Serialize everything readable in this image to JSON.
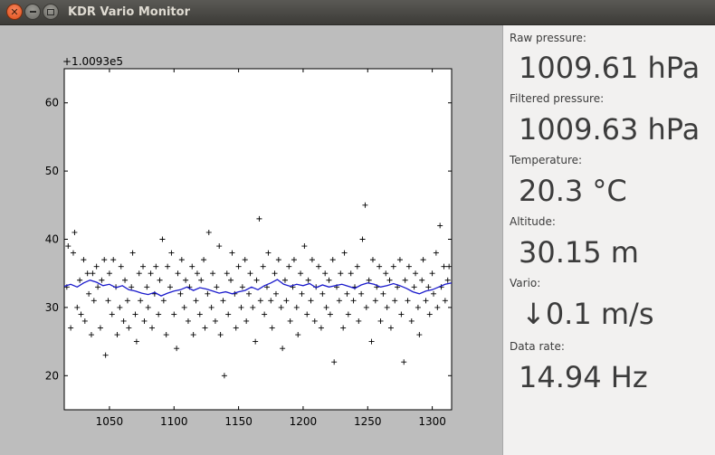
{
  "window": {
    "title": "KDR Vario Monitor",
    "close_glyph": "✕"
  },
  "readings": {
    "raw_pressure_label": "Raw pressure:",
    "raw_pressure_value": "1009.61 hPa",
    "filtered_pressure_label": "Filtered pressure:",
    "filtered_pressure_value": "1009.63 hPa",
    "temperature_label": "Temperature:",
    "temperature_value": "20.3 °C",
    "altitude_label": "Altitude:",
    "altitude_value": "30.15 m",
    "vario_label": "Vario:",
    "vario_value": "↓0.1 m/s",
    "data_rate_label": "Data rate:",
    "data_rate_value": "14.94 Hz"
  },
  "chart_data": {
    "type": "scatter",
    "offset_label": "+1.0093e5",
    "xlim": [
      1015,
      1315
    ],
    "ylim": [
      15,
      65
    ],
    "x_ticks": [
      1050,
      1100,
      1150,
      1200,
      1250,
      1300
    ],
    "y_ticks": [
      20,
      30,
      40,
      50,
      60
    ],
    "grid": false,
    "colors": {
      "raw": "#000000",
      "filtered": "#1a1acc"
    },
    "raw_points": [
      [
        1017,
        33
      ],
      [
        1018,
        39
      ],
      [
        1020,
        27
      ],
      [
        1022,
        38
      ],
      [
        1023,
        41
      ],
      [
        1025,
        30
      ],
      [
        1027,
        34
      ],
      [
        1028,
        29
      ],
      [
        1030,
        37
      ],
      [
        1031,
        28
      ],
      [
        1033,
        35
      ],
      [
        1034,
        32
      ],
      [
        1036,
        26
      ],
      [
        1037,
        35
      ],
      [
        1038,
        31
      ],
      [
        1040,
        36
      ],
      [
        1041,
        33
      ],
      [
        1043,
        27
      ],
      [
        1044,
        34
      ],
      [
        1046,
        37
      ],
      [
        1047,
        23
      ],
      [
        1049,
        31
      ],
      [
        1050,
        35
      ],
      [
        1052,
        29
      ],
      [
        1053,
        37
      ],
      [
        1055,
        33
      ],
      [
        1056,
        26
      ],
      [
        1058,
        30
      ],
      [
        1059,
        36
      ],
      [
        1061,
        28
      ],
      [
        1062,
        34
      ],
      [
        1064,
        31
      ],
      [
        1065,
        27
      ],
      [
        1067,
        33
      ],
      [
        1068,
        38
      ],
      [
        1070,
        29
      ],
      [
        1071,
        25
      ],
      [
        1073,
        35
      ],
      [
        1074,
        31
      ],
      [
        1076,
        36
      ],
      [
        1077,
        28
      ],
      [
        1079,
        33
      ],
      [
        1080,
        30
      ],
      [
        1082,
        35
      ],
      [
        1083,
        27
      ],
      [
        1085,
        32
      ],
      [
        1086,
        36
      ],
      [
        1088,
        29
      ],
      [
        1089,
        34
      ],
      [
        1091,
        40
      ],
      [
        1092,
        31
      ],
      [
        1094,
        26
      ],
      [
        1095,
        36
      ],
      [
        1097,
        33
      ],
      [
        1098,
        38
      ],
      [
        1100,
        29
      ],
      [
        1102,
        24
      ],
      [
        1103,
        35
      ],
      [
        1105,
        32
      ],
      [
        1106,
        37
      ],
      [
        1108,
        30
      ],
      [
        1109,
        34
      ],
      [
        1111,
        28
      ],
      [
        1112,
        33
      ],
      [
        1114,
        36
      ],
      [
        1115,
        26
      ],
      [
        1117,
        31
      ],
      [
        1118,
        35
      ],
      [
        1120,
        29
      ],
      [
        1121,
        34
      ],
      [
        1123,
        37
      ],
      [
        1124,
        27
      ],
      [
        1126,
        32
      ],
      [
        1127,
        41
      ],
      [
        1129,
        30
      ],
      [
        1130,
        35
      ],
      [
        1132,
        28
      ],
      [
        1133,
        33
      ],
      [
        1135,
        39
      ],
      [
        1136,
        26
      ],
      [
        1138,
        31
      ],
      [
        1139,
        20
      ],
      [
        1141,
        35
      ],
      [
        1142,
        29
      ],
      [
        1144,
        34
      ],
      [
        1145,
        38
      ],
      [
        1147,
        32
      ],
      [
        1148,
        27
      ],
      [
        1150,
        36
      ],
      [
        1152,
        30
      ],
      [
        1153,
        33
      ],
      [
        1155,
        37
      ],
      [
        1156,
        28
      ],
      [
        1158,
        32
      ],
      [
        1159,
        35
      ],
      [
        1161,
        30
      ],
      [
        1163,
        25
      ],
      [
        1164,
        34
      ],
      [
        1166,
        43
      ],
      [
        1167,
        31
      ],
      [
        1169,
        36
      ],
      [
        1170,
        29
      ],
      [
        1172,
        33
      ],
      [
        1173,
        38
      ],
      [
        1175,
        31
      ],
      [
        1176,
        27
      ],
      [
        1178,
        35
      ],
      [
        1179,
        32
      ],
      [
        1181,
        37
      ],
      [
        1183,
        30
      ],
      [
        1184,
        24
      ],
      [
        1186,
        34
      ],
      [
        1187,
        31
      ],
      [
        1189,
        36
      ],
      [
        1190,
        28
      ],
      [
        1192,
        33
      ],
      [
        1193,
        37
      ],
      [
        1195,
        30
      ],
      [
        1196,
        26
      ],
      [
        1198,
        35
      ],
      [
        1199,
        32
      ],
      [
        1201,
        39
      ],
      [
        1203,
        29
      ],
      [
        1204,
        34
      ],
      [
        1206,
        31
      ],
      [
        1207,
        37
      ],
      [
        1209,
        28
      ],
      [
        1210,
        33
      ],
      [
        1212,
        36
      ],
      [
        1214,
        27
      ],
      [
        1215,
        32
      ],
      [
        1217,
        35
      ],
      [
        1218,
        30
      ],
      [
        1220,
        34
      ],
      [
        1221,
        29
      ],
      [
        1223,
        37
      ],
      [
        1224,
        22
      ],
      [
        1226,
        33
      ],
      [
        1228,
        31
      ],
      [
        1229,
        35
      ],
      [
        1231,
        27
      ],
      [
        1232,
        38
      ],
      [
        1234,
        32
      ],
      [
        1235,
        29
      ],
      [
        1237,
        35
      ],
      [
        1239,
        31
      ],
      [
        1240,
        33
      ],
      [
        1242,
        36
      ],
      [
        1243,
        28
      ],
      [
        1245,
        32
      ],
      [
        1246,
        40
      ],
      [
        1248,
        45
      ],
      [
        1249,
        30
      ],
      [
        1251,
        34
      ],
      [
        1253,
        25
      ],
      [
        1254,
        37
      ],
      [
        1256,
        31
      ],
      [
        1257,
        33
      ],
      [
        1259,
        36
      ],
      [
        1260,
        28
      ],
      [
        1262,
        32
      ],
      [
        1264,
        35
      ],
      [
        1265,
        30
      ],
      [
        1267,
        34
      ],
      [
        1268,
        27
      ],
      [
        1270,
        36
      ],
      [
        1271,
        31
      ],
      [
        1273,
        33
      ],
      [
        1275,
        37
      ],
      [
        1276,
        29
      ],
      [
        1278,
        22
      ],
      [
        1279,
        34
      ],
      [
        1281,
        31
      ],
      [
        1282,
        36
      ],
      [
        1284,
        28
      ],
      [
        1286,
        33
      ],
      [
        1287,
        35
      ],
      [
        1289,
        30
      ],
      [
        1290,
        26
      ],
      [
        1292,
        34
      ],
      [
        1293,
        37
      ],
      [
        1295,
        31
      ],
      [
        1297,
        33
      ],
      [
        1298,
        29
      ],
      [
        1300,
        35
      ],
      [
        1301,
        32
      ],
      [
        1303,
        38
      ],
      [
        1304,
        30
      ],
      [
        1306,
        42
      ],
      [
        1307,
        33
      ],
      [
        1309,
        36
      ],
      [
        1310,
        31
      ],
      [
        1312,
        34
      ],
      [
        1313,
        36
      ]
    ],
    "filtered_line": [
      [
        1015,
        33.1
      ],
      [
        1020,
        33.4
      ],
      [
        1025,
        33.0
      ],
      [
        1030,
        33.6
      ],
      [
        1035,
        34.0
      ],
      [
        1040,
        33.7
      ],
      [
        1045,
        33.2
      ],
      [
        1050,
        33.4
      ],
      [
        1055,
        32.9
      ],
      [
        1060,
        33.2
      ],
      [
        1065,
        32.6
      ],
      [
        1070,
        32.4
      ],
      [
        1075,
        32.1
      ],
      [
        1080,
        31.9
      ],
      [
        1085,
        32.2
      ],
      [
        1090,
        31.7
      ],
      [
        1095,
        32.1
      ],
      [
        1100,
        32.4
      ],
      [
        1105,
        32.6
      ],
      [
        1110,
        33.0
      ],
      [
        1115,
        32.5
      ],
      [
        1120,
        32.9
      ],
      [
        1125,
        32.7
      ],
      [
        1130,
        32.4
      ],
      [
        1135,
        32.1
      ],
      [
        1140,
        32.3
      ],
      [
        1145,
        32.0
      ],
      [
        1150,
        32.3
      ],
      [
        1155,
        32.5
      ],
      [
        1160,
        33.0
      ],
      [
        1165,
        32.6
      ],
      [
        1170,
        33.2
      ],
      [
        1175,
        33.6
      ],
      [
        1180,
        34.1
      ],
      [
        1185,
        33.4
      ],
      [
        1190,
        33.1
      ],
      [
        1195,
        33.4
      ],
      [
        1200,
        33.2
      ],
      [
        1205,
        33.5
      ],
      [
        1210,
        32.9
      ],
      [
        1215,
        33.3
      ],
      [
        1220,
        33.0
      ],
      [
        1225,
        33.2
      ],
      [
        1230,
        33.4
      ],
      [
        1235,
        33.1
      ],
      [
        1240,
        32.8
      ],
      [
        1245,
        33.3
      ],
      [
        1250,
        33.6
      ],
      [
        1255,
        33.4
      ],
      [
        1260,
        33.0
      ],
      [
        1265,
        33.2
      ],
      [
        1270,
        33.5
      ],
      [
        1275,
        33.2
      ],
      [
        1280,
        32.8
      ],
      [
        1285,
        32.3
      ],
      [
        1290,
        32.0
      ],
      [
        1295,
        32.4
      ],
      [
        1300,
        32.6
      ],
      [
        1305,
        33.0
      ],
      [
        1310,
        33.4
      ],
      [
        1315,
        33.6
      ]
    ]
  }
}
